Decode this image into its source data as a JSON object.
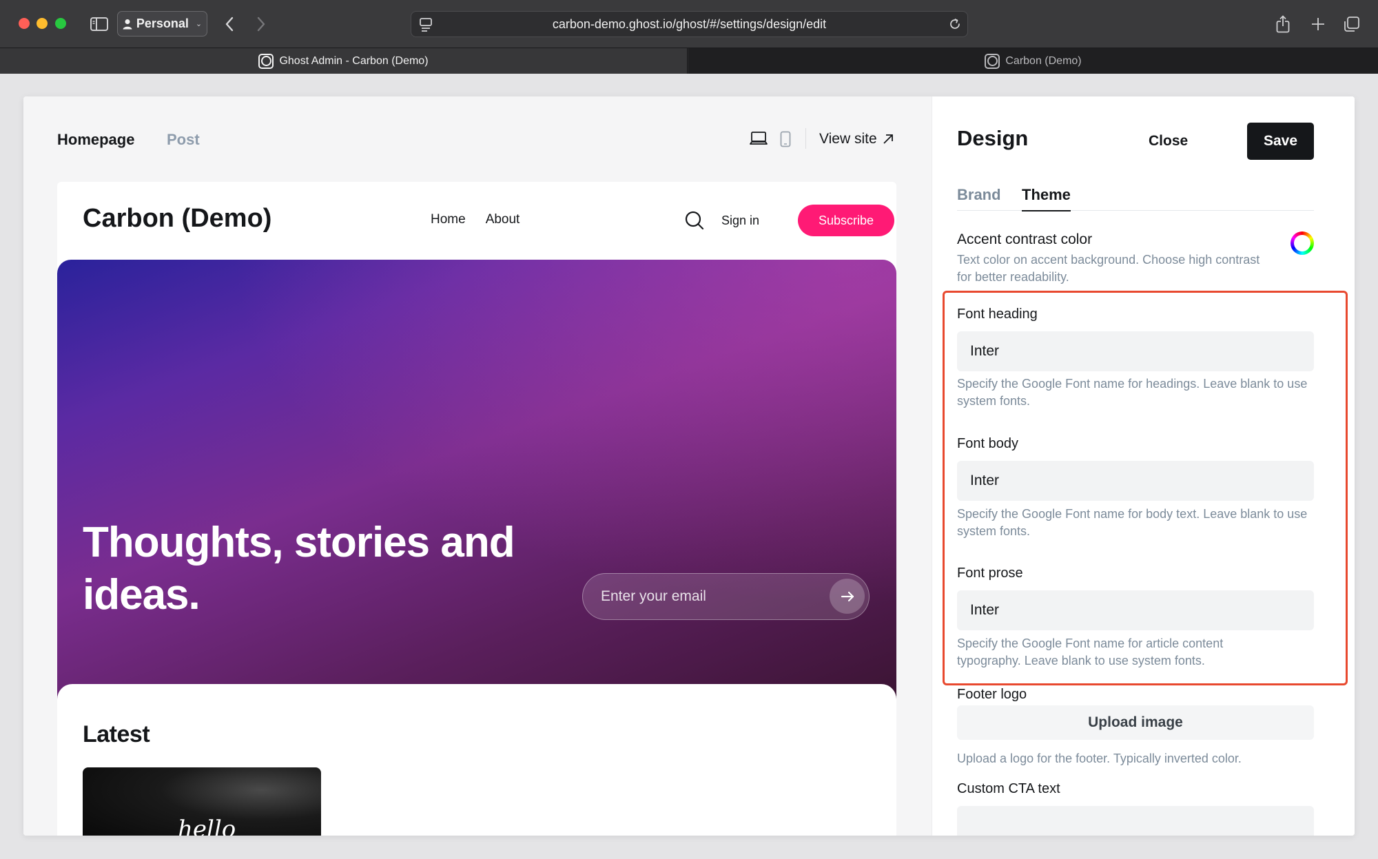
{
  "browser": {
    "profile_label": "Personal",
    "url": "carbon-demo.ghost.io/ghost/#/settings/design/edit",
    "tabs": [
      {
        "title": "Ghost Admin - Carbon (Demo)"
      },
      {
        "title": "Carbon (Demo)"
      }
    ]
  },
  "preview": {
    "tabs": [
      "Homepage",
      "Post"
    ],
    "view_site_label": "View site",
    "site": {
      "title": "Carbon (Demo)",
      "nav": [
        "Home",
        "About"
      ],
      "signin_label": "Sign in",
      "subscribe_label": "Subscribe",
      "hero_title": "Thoughts, stories and ideas.",
      "email_placeholder": "Enter your email",
      "latest_title": "Latest",
      "card_script_text": "hello"
    }
  },
  "settings": {
    "title": "Design",
    "close_label": "Close",
    "save_label": "Save",
    "tabs": [
      "Brand",
      "Theme"
    ],
    "active_tab": "Theme",
    "accent_contrast": {
      "label": "Accent contrast color",
      "hint": "Text color on accent background. Choose high contrast for better readability."
    },
    "font_heading": {
      "label": "Font heading",
      "value": "Inter",
      "hint": "Specify the Google Font name for headings. Leave blank to use system fonts."
    },
    "font_body": {
      "label": "Font body",
      "value": "Inter",
      "hint": "Specify the Google Font name for body text. Leave blank to use system fonts."
    },
    "font_prose": {
      "label": "Font prose",
      "value": "Inter",
      "hint": "Specify the Google Font name for article content typography. Leave blank to use system fonts."
    },
    "footer_logo": {
      "label": "Footer logo",
      "button_label": "Upload image",
      "hint": "Upload a logo for the footer. Typically inverted color."
    },
    "custom_cta": {
      "label": "Custom CTA text",
      "value": ""
    }
  },
  "colors": {
    "subscribe_accent": "#ff1a75",
    "highlight_outline": "#e8492f",
    "save_button": "#15171a"
  }
}
